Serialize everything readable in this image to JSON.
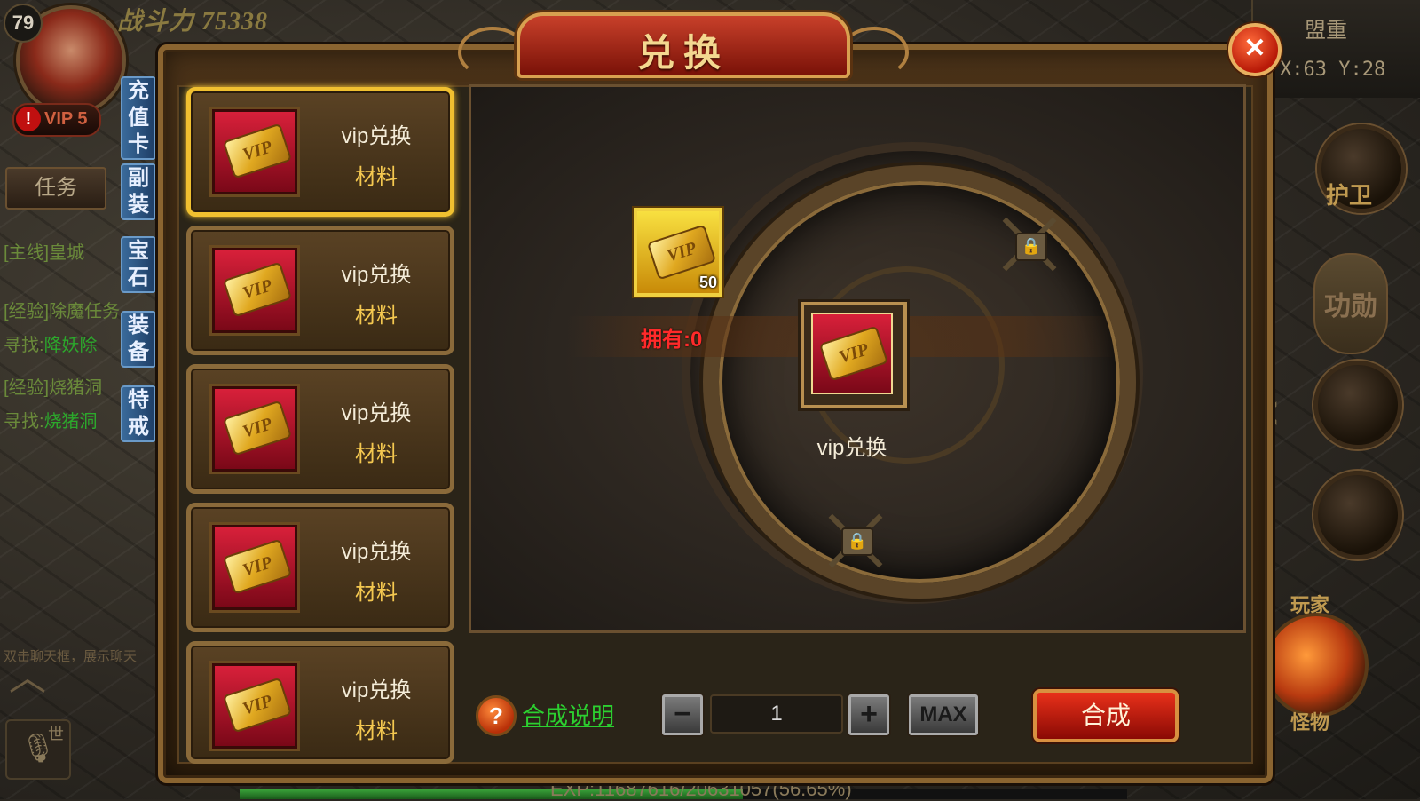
{
  "hud": {
    "level": "79",
    "power_label": "战斗力",
    "power_value": "75338",
    "vip_label": "VIP 5",
    "side_tabs": [
      "充值卡",
      "副装",
      "宝石",
      "装备",
      "特戒"
    ],
    "task_button": "任务",
    "quests": [
      {
        "tag": "[主线]",
        "text": "皇城"
      },
      {
        "tag": "[经验]",
        "text": "除魔任务"
      },
      {
        "tag": "寻找:",
        "text": "降妖除"
      },
      {
        "tag": "[经验]",
        "text": "烧猪洞"
      },
      {
        "tag": "寻找:",
        "text": "烧猪洞"
      }
    ],
    "chat_hint": "双击聊天框，展示聊天",
    "mic_label": "世",
    "alliance": "盟重",
    "coords": "X:63 Y:28",
    "guard_label": "护卫",
    "merit_label": "功勋",
    "player_label": "玩家",
    "monster_label": "怪物",
    "exp_text": "EXP:11687616/20631057(56.65%)",
    "exp_percent": 56.65
  },
  "dialog": {
    "title": "兑换",
    "close_icon": "✕",
    "items": [
      {
        "name": "vip兑换",
        "sub": "材料",
        "selected": true
      },
      {
        "name": "vip兑换",
        "sub": "材料",
        "selected": false
      },
      {
        "name": "vip兑换",
        "sub": "材料",
        "selected": false
      },
      {
        "name": "vip兑换",
        "sub": "材料",
        "selected": false
      },
      {
        "name": "vip兑换",
        "sub": "材料",
        "selected": false
      }
    ],
    "ticket_text": "VIP",
    "material": {
      "count": "50",
      "owned_label": "拥有:0"
    },
    "result": {
      "name": "vip兑换"
    },
    "help_label": "合成说明",
    "quantity": "1",
    "minus": "−",
    "plus": "+",
    "max_label": "MAX",
    "synthesize_label": "合成"
  }
}
